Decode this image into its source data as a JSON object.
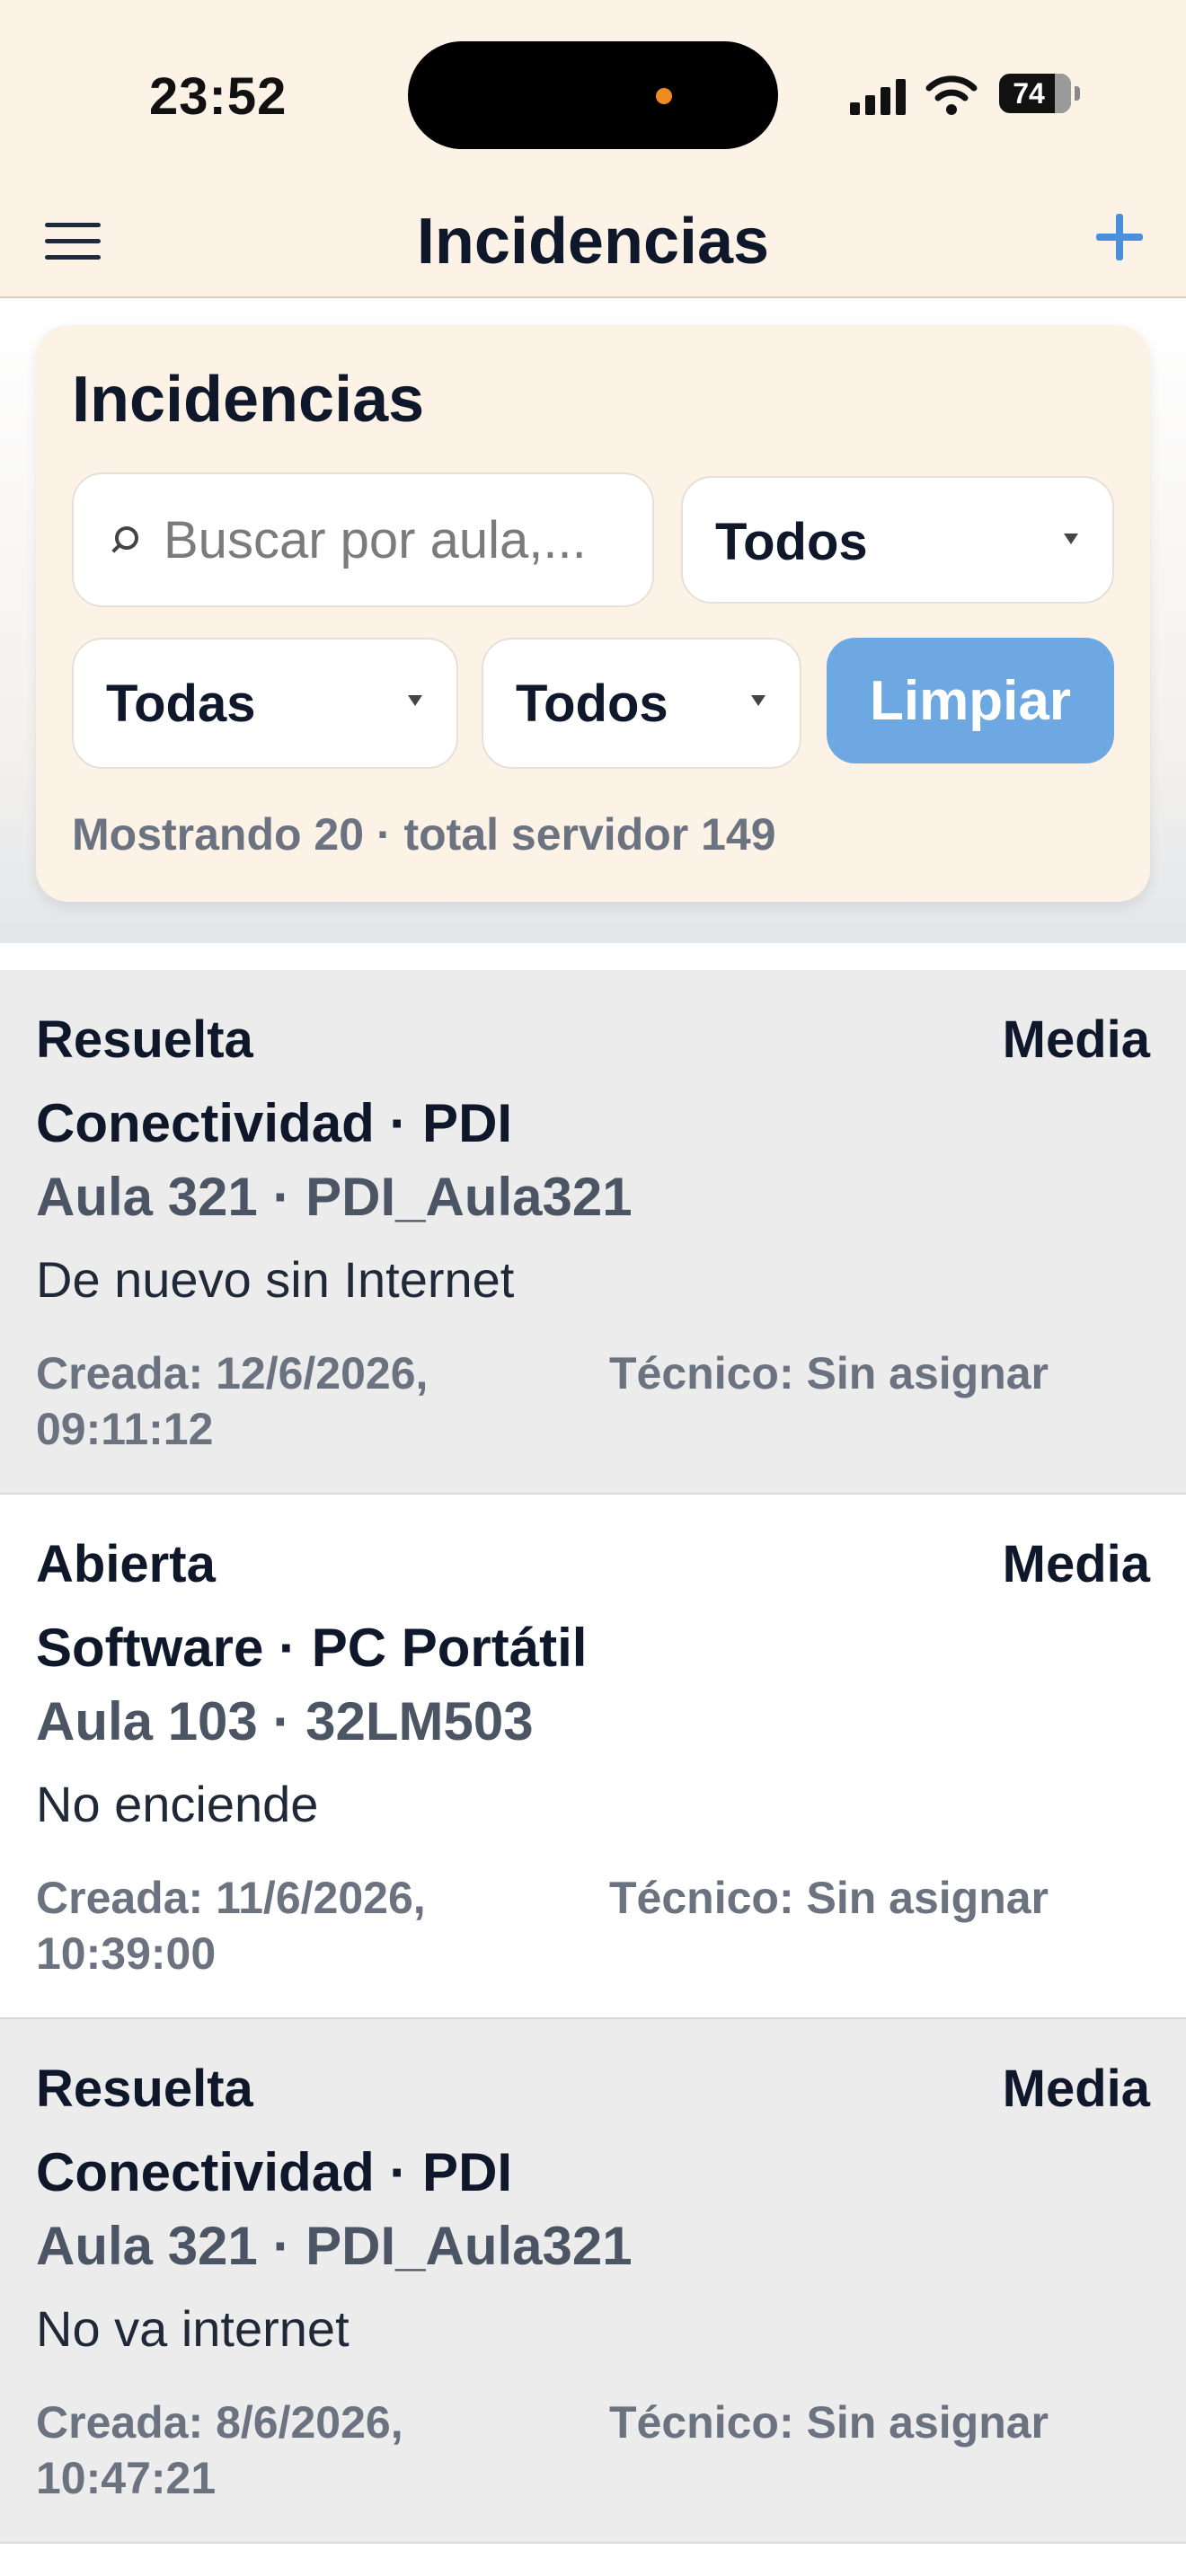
{
  "status_bar": {
    "time": "23:52",
    "battery": "74",
    "icons": [
      "cellular-signal-icon",
      "wifi-icon",
      "battery-icon"
    ]
  },
  "nav": {
    "title": "Incidencias",
    "left_icon": "hamburger-menu-icon",
    "right_icon": "plus-icon",
    "accent_color": "#4a8fdc"
  },
  "filters": {
    "title": "Incidencias",
    "search_placeholder": "Buscar por aula,...",
    "estado_value": "Todos",
    "categoria_value": "Todas",
    "prioridad_value": "Todos",
    "clear_label": "Limpiar",
    "summary": "Mostrando 20 · total servidor 149"
  },
  "incidencias": [
    {
      "estado": "Resuelta",
      "prioridad": "Media",
      "categoria": "Conectividad · PDI",
      "aula": "Aula 321 · PDI_Aula321",
      "descripcion": "De nuevo sin Internet",
      "creada": "Creada: 12/6/2026, 09:11:12",
      "tecnico": "Técnico: Sin asignar"
    },
    {
      "estado": "Abierta",
      "prioridad": "Media",
      "categoria": "Software · PC Portátil",
      "aula": "Aula 103 · 32LM503",
      "descripcion": "No enciende",
      "creada": "Creada: 11/6/2026, 10:39:00",
      "tecnico": "Técnico: Sin asignar"
    },
    {
      "estado": "Resuelta",
      "prioridad": "Media",
      "categoria": "Conectividad · PDI",
      "aula": "Aula 321 · PDI_Aula321",
      "descripcion": "No va internet",
      "creada": "Creada: 8/6/2026, 10:47:21",
      "tecnico": "Técnico: Sin asignar"
    }
  ]
}
